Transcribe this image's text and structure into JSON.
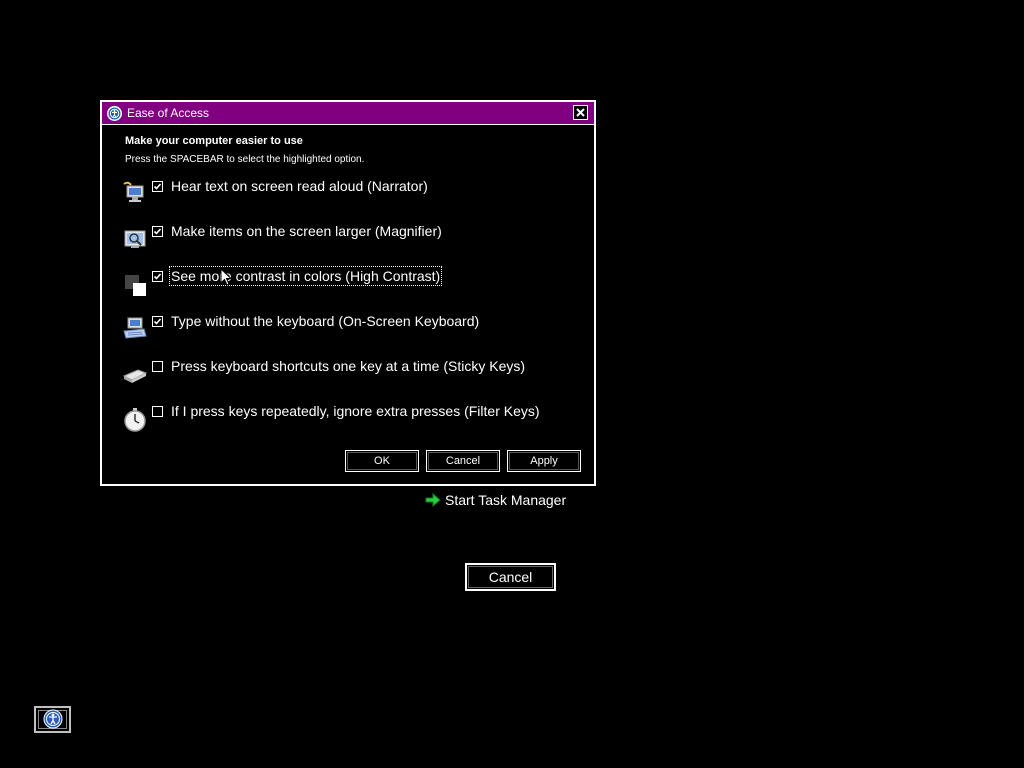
{
  "dialog": {
    "title": "Ease of Access",
    "heading": "Make your computer easier to use",
    "subheading": "Press the SPACEBAR to select the highlighted option.",
    "options": [
      {
        "label": "Hear text on screen read aloud (Narrator)",
        "checked": true,
        "icon": "narrator-icon"
      },
      {
        "label": "Make items on the screen larger (Magnifier)",
        "checked": true,
        "icon": "magnifier-icon"
      },
      {
        "label": "See more contrast in colors (High Contrast)",
        "checked": true,
        "icon": "high-contrast-icon",
        "focused": true
      },
      {
        "label": "Type without the keyboard (On-Screen Keyboard)",
        "checked": true,
        "icon": "on-screen-keyboard-icon"
      },
      {
        "label": "Press keyboard shortcuts one key at a time (Sticky Keys)",
        "checked": false,
        "icon": "sticky-keys-icon"
      },
      {
        "label": "If I press keys repeatedly, ignore extra presses (Filter Keys)",
        "checked": false,
        "icon": "filter-keys-icon"
      }
    ],
    "buttons": {
      "ok": "OK",
      "cancel": "Cancel",
      "apply": "Apply"
    }
  },
  "task_manager": {
    "label": "Start Task Manager",
    "icon": "green-arrow-icon"
  },
  "cancel_button": {
    "label": "Cancel"
  },
  "ease_of_access_button": {
    "icon": "ease-of-access-icon"
  },
  "colors": {
    "background": "#000000",
    "titlebar": "#800080",
    "text": "#ffffff",
    "arrow": "#2ecc40"
  }
}
